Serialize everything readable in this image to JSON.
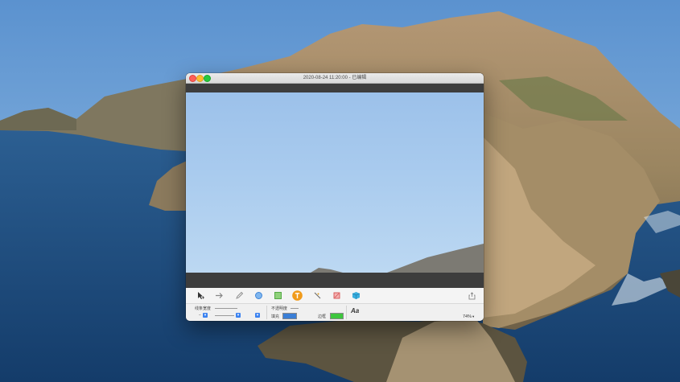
{
  "window": {
    "title": "2020-08-24 11:20:00 - 已编辑"
  },
  "toolbar": {
    "tools": [
      {
        "name": "select-tool",
        "icon": "cursor-icon"
      },
      {
        "name": "arrow-tool",
        "icon": "arrow-right-icon"
      },
      {
        "name": "pen-tool",
        "icon": "pencil-icon"
      },
      {
        "name": "circle-tool",
        "icon": "circle-icon"
      },
      {
        "name": "rectangle-tool",
        "icon": "square-icon"
      },
      {
        "name": "text-tool",
        "icon": "text-t-icon",
        "active": true
      },
      {
        "name": "magic-tool",
        "icon": "magic-wand-icon"
      },
      {
        "name": "crop-tool",
        "icon": "crop-icon"
      },
      {
        "name": "color-tool",
        "icon": "cube-icon"
      }
    ],
    "share_icon": "share-icon"
  },
  "props": {
    "line_width_label": "线条宽度",
    "opacity_label": "不透明度",
    "fill_label": "填充",
    "border_label": "边框",
    "font_label": "Aa",
    "zoom": "74%",
    "fill_color": "#3b7fd6",
    "border_color": "#3ec63e",
    "accent_color": "#f09a1a"
  }
}
